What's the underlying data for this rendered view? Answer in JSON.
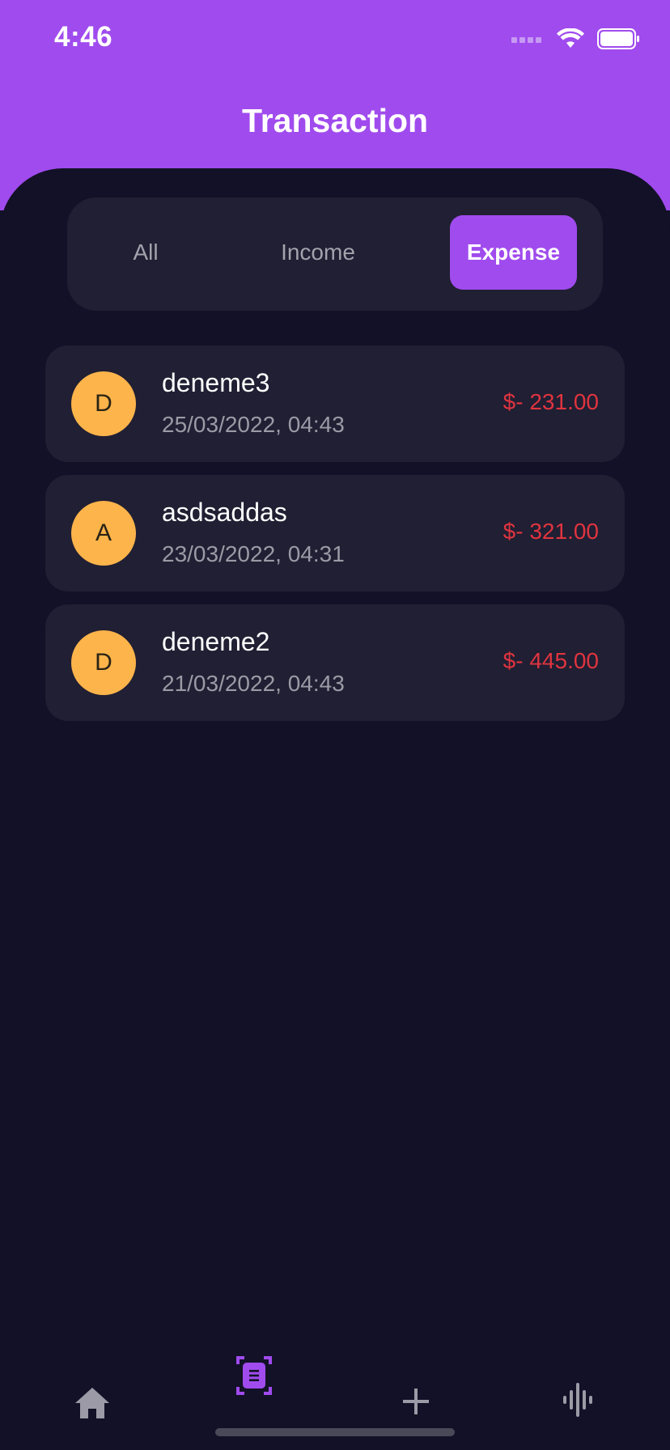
{
  "status_bar": {
    "time": "4:46"
  },
  "header": {
    "title": "Transaction"
  },
  "filter": {
    "options": [
      "All",
      "Income",
      "Expense"
    ],
    "selected": "Expense"
  },
  "transactions": [
    {
      "initial": "D",
      "name": "deneme3",
      "date": "25/03/2022, 04:43",
      "amount": "$- 231.00"
    },
    {
      "initial": "A",
      "name": "asdsaddas",
      "date": "23/03/2022, 04:31",
      "amount": "$- 321.00"
    },
    {
      "initial": "D",
      "name": "deneme2",
      "date": "21/03/2022, 04:43",
      "amount": "$- 445.00"
    }
  ],
  "tab_bar": {
    "items": [
      "home-icon",
      "transactions-icon",
      "add-icon",
      "statistics-icon"
    ],
    "active": "transactions-icon"
  },
  "colors": {
    "accent": "#a04bee",
    "background": "#121127",
    "card": "#201f33",
    "avatar": "#fdb44b",
    "expense": "#e0343f"
  }
}
